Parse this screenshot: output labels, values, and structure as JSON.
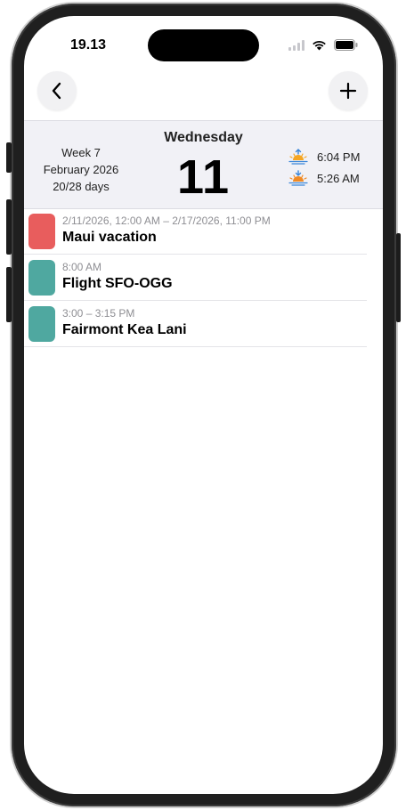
{
  "status_bar": {
    "time": "19.13"
  },
  "nav": {
    "back_icon": "chevron-left-icon",
    "add_icon": "plus-icon"
  },
  "day_header": {
    "week": "Week 7",
    "month": "February 2026",
    "days_progress": "20/28 days",
    "weekday": "Wednesday",
    "day": "11",
    "sunset_time": "6:04 PM",
    "sunrise_time": "5:26 AM"
  },
  "events": [
    {
      "time": "2/11/2026, 12:00 AM – 2/17/2026, 11:00 PM",
      "title": "Maui vacation",
      "color": "#e85d5d"
    },
    {
      "time": "8:00 AM",
      "title": "Flight SFO-OGG",
      "color": "#4fa8a0"
    },
    {
      "time": "3:00 – 3:15 PM",
      "title": "Fairmont Kea Lani",
      "color": "#4fa8a0"
    }
  ]
}
